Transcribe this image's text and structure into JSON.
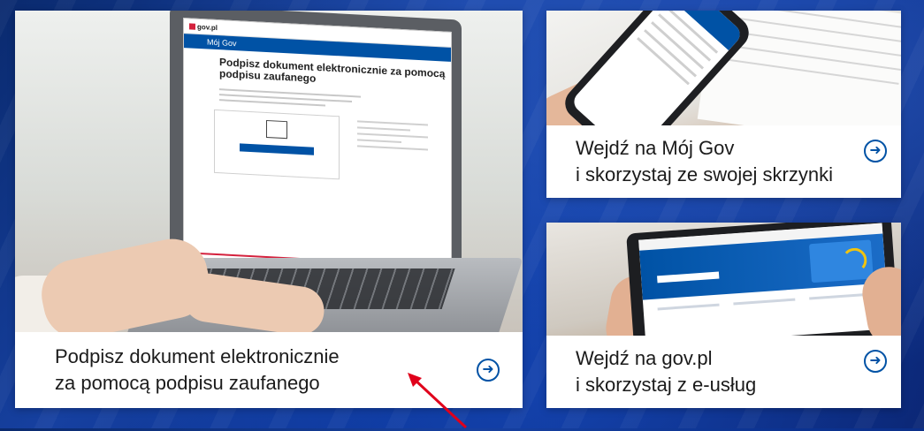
{
  "cards": {
    "main": {
      "caption_line1": "Podpisz dokument elektronicznie",
      "caption_line2": "za pomocą podpisu zaufanego",
      "screen": {
        "logo": "gov.pl",
        "nav": "Mój Gov",
        "title": "Podpisz dokument elektronicznie za pomocą podpisu zaufanego"
      }
    },
    "top": {
      "caption_line1": "Wejdź na Mój Gov",
      "caption_line2": "i skorzystaj ze swojej skrzynki"
    },
    "bottom": {
      "caption_line1": "Wejdź na gov.pl",
      "caption_line2": "i skorzystaj z e-usług"
    }
  },
  "icons": {
    "arrow": "arrow-right-circle-icon"
  },
  "colors": {
    "accent_blue": "#0052a5",
    "gov_red": "#d4213d",
    "annotation_red": "#e0001b"
  }
}
